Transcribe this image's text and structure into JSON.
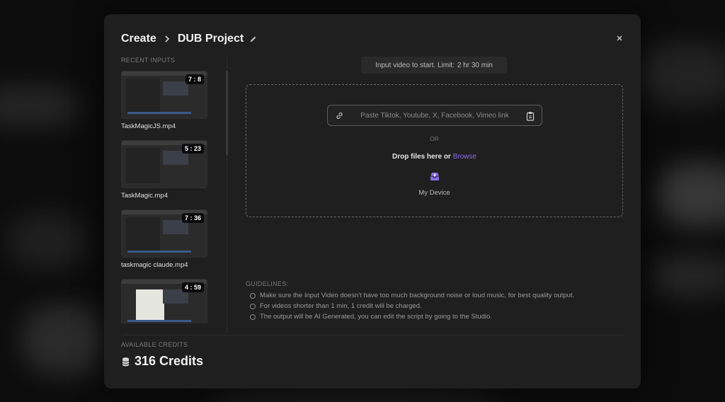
{
  "header": {
    "root": "Create",
    "project_name": "DUB Project"
  },
  "recent": {
    "title": "RECENT INPUTS",
    "items": [
      {
        "name": "TaskMagicJS.mp4",
        "duration": "7 : 8"
      },
      {
        "name": "TaskMagic.mp4",
        "duration": "5 : 23"
      },
      {
        "name": "taskmagic claude.mp4",
        "duration": "7 : 36"
      },
      {
        "name": "",
        "duration": "4 : 59"
      }
    ]
  },
  "limit": {
    "text": "Input video to start. Limit:",
    "value": "2 hr 30 min"
  },
  "dropzone": {
    "link_placeholder": "Paste Tiktok, Youtube, X, Facebook, Vimeo link",
    "or_text": "OR",
    "drop_text": "Drop files here or",
    "browse_label": "Browse",
    "device_label": "My Device"
  },
  "guidelines": {
    "title": "GUIDELINES:",
    "items": [
      "Make sure the Input Video doesn't have too much background noise or loud music, for best quality output.",
      "For videos shorter than 1 min, 1 credit will be charged.",
      "The output will be AI Generated, you can edit the script by going to the Studio."
    ]
  },
  "credits": {
    "title": "AVAILABLE CREDITS",
    "value": "316 Credits"
  },
  "colors": {
    "accent": "#8b6ee8",
    "modal_bg": "#1f1f1f"
  },
  "icons": [
    "chevron-right-icon",
    "pencil-icon",
    "close-icon",
    "link-icon",
    "clipboard-icon",
    "inbox-icon",
    "coins-icon"
  ]
}
